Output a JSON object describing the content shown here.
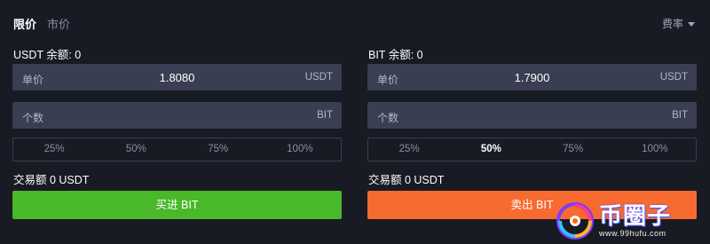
{
  "tabs": [
    {
      "label": "限价",
      "active": true
    },
    {
      "label": "市价",
      "active": false
    }
  ],
  "fee_label": "费率",
  "buy": {
    "balance": "USDT 余额: 0",
    "price_label": "单价",
    "price_value": "1.8080",
    "price_unit": "USDT",
    "qty_label": "个数",
    "qty_unit": "BIT",
    "percents": [
      "25%",
      "50%",
      "75%",
      "100%"
    ],
    "active_percent": null,
    "amount": "交易额 0 USDT",
    "button": "买进 BIT",
    "button_color": "#49b829"
  },
  "sell": {
    "balance": "BIT 余额: 0",
    "price_label": "单价",
    "price_value": "1.7900",
    "price_unit": "USDT",
    "qty_label": "个数",
    "qty_unit": "BIT",
    "percents": [
      "25%",
      "50%",
      "75%",
      "100%"
    ],
    "active_percent": "50%",
    "amount": "交易额 0 USDT",
    "button": "卖出 BIT",
    "button_color": "#f76a30"
  },
  "watermark": {
    "title": "币圈子",
    "url": "www.99hufu.com"
  }
}
